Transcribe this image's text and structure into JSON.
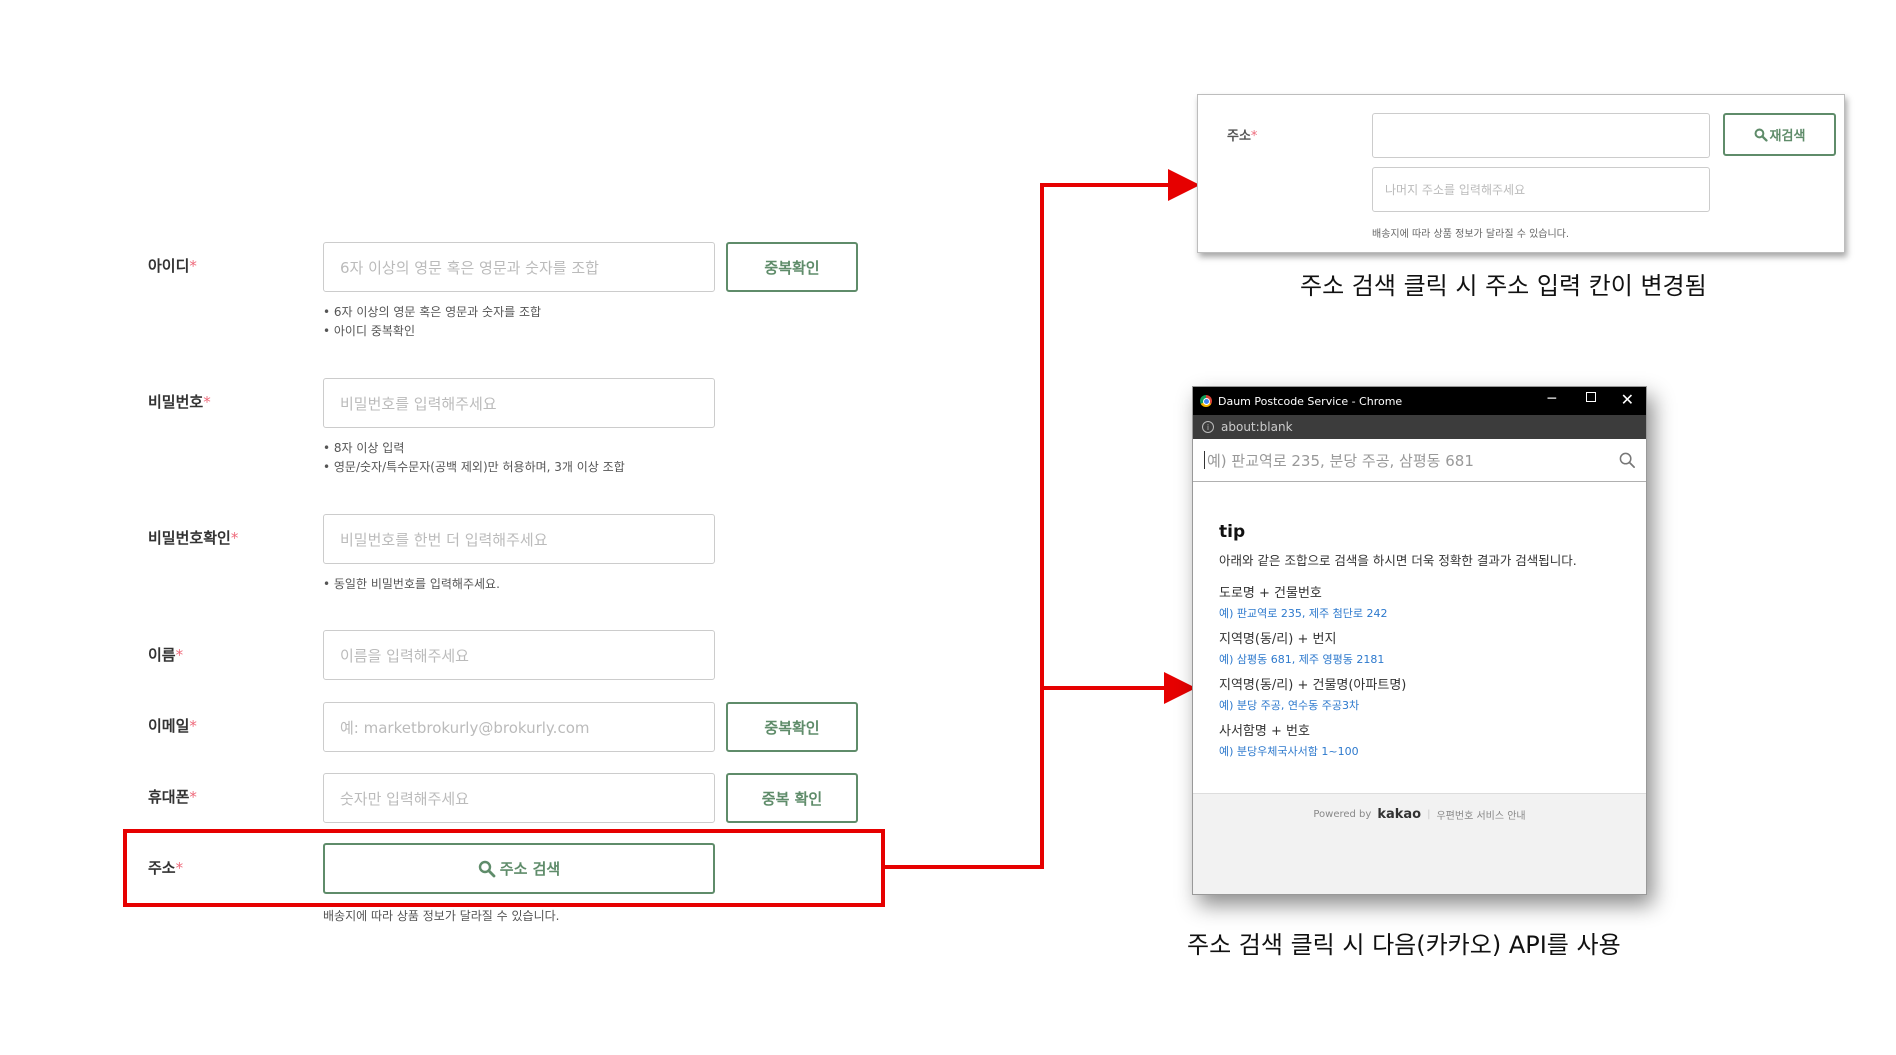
{
  "form": {
    "id_label": "아이디",
    "required_mark": "*",
    "id_placeholder": "6자 이상의 영문 혹은 영문과 숫자를 조합",
    "id_check_button": "중복확인",
    "id_hints": [
      "• 6자 이상의 영문 혹은 영문과 숫자를 조합",
      "• 아이디 중복확인"
    ],
    "pw_label": "비밀번호",
    "pw_placeholder": "비밀번호를 입력해주세요",
    "pw_hints": [
      "• 8자 이상 입력",
      "• 영문/숫자/특수문자(공백 제외)만 허용하며, 3개 이상 조합"
    ],
    "pw2_label": "비밀번호확인",
    "pw2_placeholder": "비밀번호를 한번 더 입력해주세요",
    "pw2_hint": "• 동일한 비밀번호를 입력해주세요.",
    "name_label": "이름",
    "name_placeholder": "이름을 입력해주세요",
    "email_label": "이메일",
    "email_placeholder": "예: marketbrokurly@brokurly.com",
    "email_check_button": "중복확인",
    "phone_label": "휴대폰",
    "phone_placeholder": "숫자만 입력해주세요",
    "phone_check_button": "중복 확인",
    "address_label": "주소",
    "address_search_button": "주소 검색",
    "address_note": "배송지에 따라 상품 정보가 달라질 수 있습니다."
  },
  "address_panel": {
    "label": "주소",
    "research_button": "재검색",
    "detail_placeholder": "나머지 주소를 입력해주세요",
    "note": "배송지에 따라 상품 정보가 달라질 수 있습니다.",
    "caption": "주소 검색 클릭 시 주소 입력 칸이 변경됨"
  },
  "popup": {
    "window_title": "Daum Postcode Service - Chrome",
    "url": "about:blank",
    "search_placeholder": "예) 판교역로 235, 분당 주공, 삼평동 681",
    "tip_title": "tip",
    "tip_desc": "아래와 같은 조합으로 검색을 하시면 더욱 정확한 결과가 검색됩니다.",
    "tips": [
      {
        "title": "도로명 + 건물번호",
        "example": "예) 판교역로 235,  제주 첨단로 242"
      },
      {
        "title": "지역명(동/리) + 번지",
        "example": "예) 삼평동 681,  제주 영평동 2181"
      },
      {
        "title": "지역명(동/리) + 건물명(아파트명)",
        "example": "예) 분당 주공,  연수동 주공3차"
      },
      {
        "title": "사서함명 + 번호",
        "example": "예) 분당우체국사서함 1~100"
      }
    ],
    "powered_by": "Powered by",
    "brand": "kakao",
    "service_link": "우편번호 서비스 안내",
    "caption": "주소 검색 클릭 시 다음(카카오) API를 사용"
  },
  "colors": {
    "accent_green": "#5f8c6a",
    "highlight_red": "#e60000",
    "required_pink": "#ee6a7b",
    "link_blue": "#2d79cd"
  }
}
